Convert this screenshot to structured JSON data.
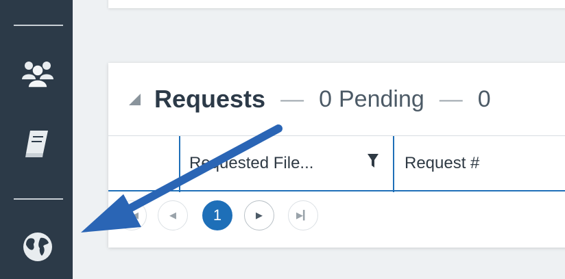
{
  "sidebar": {
    "items": [
      {
        "icon": "users-icon"
      },
      {
        "icon": "book-icon"
      },
      {
        "icon": "globe-icon"
      }
    ]
  },
  "requests_panel": {
    "title": "Requests",
    "separator": "—",
    "pending_count": "0",
    "pending_label": "Pending",
    "trailing_text": "0",
    "columns": [
      {
        "label": "Requested File..."
      },
      {
        "label": "Request #"
      }
    ]
  },
  "pager": {
    "current_page": "1",
    "buttons": [
      "first-page",
      "prev-page",
      "1",
      "next-page",
      "last-page"
    ]
  },
  "colors": {
    "sidebar_bg": "#2c3a48",
    "accent": "#1e6fb8",
    "arrow": "#2a65b5"
  }
}
